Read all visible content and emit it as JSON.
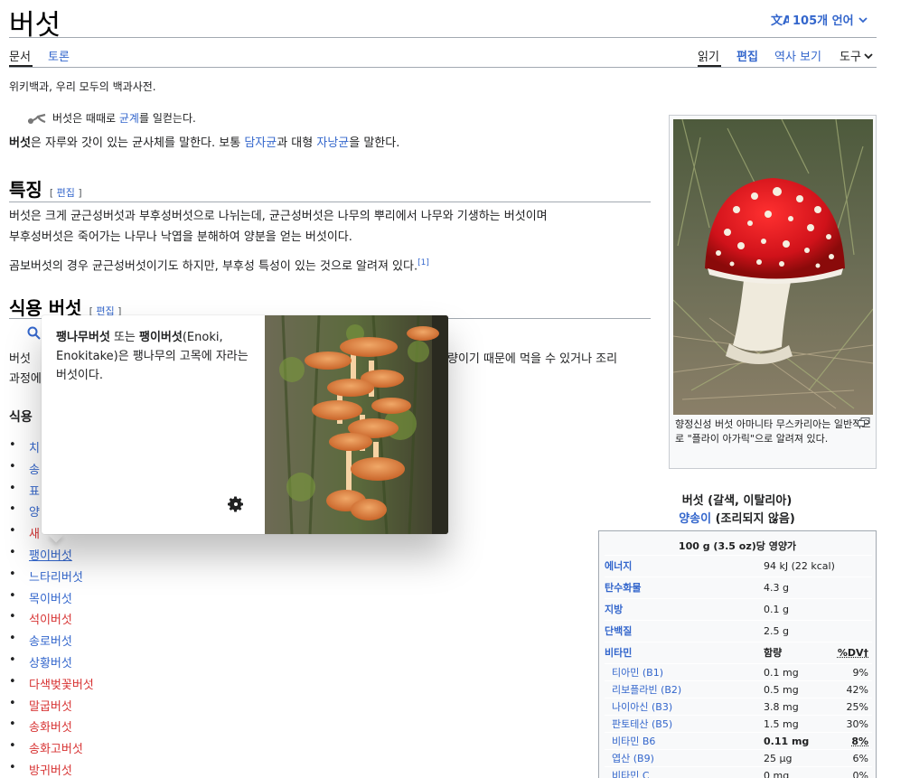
{
  "page": {
    "title": "버섯",
    "languages": "105개 언어",
    "tagline": "위키백과, 우리 모두의 백과사전."
  },
  "tabs": {
    "doc": "문서",
    "talk": "토론",
    "read": "읽기",
    "edit": "편집",
    "history": "역사 보기",
    "tools": "도구"
  },
  "hatnote": {
    "prefix": "버섯은 때때로 ",
    "link": "균계",
    "suffix": "를 일컫는다."
  },
  "intro": {
    "bold": "버섯",
    "t1": "은 자루와 갓이 있는 균사체를 말한다. 보통 ",
    "l1": "담자균",
    "t2": "과 대형 ",
    "l2": "자낭균",
    "t3": "을 말한다."
  },
  "sections": {
    "features": {
      "title": "특징",
      "edit": "편집",
      "p1": "버섯은 크게 균근성버섯과 부후성버섯으로 나뉘는데, 균근성버섯은 나무의 뿌리에서 나무와 기생하는 버섯이며",
      "p2": "부후성버섯은 죽어가는 나무나 낙엽을 분해하여 양분을 얻는 버섯이다.",
      "p3": "곰보버섯의 경우 균근성버섯이기도 하지만, 부후성 특성이 있는 것으로 알려져 있다.",
      "ref": "[1]"
    },
    "edible": {
      "title": "식용 버섯",
      "edit": "편집",
      "p_frag1": "버섯 ",
      "p_frag2": "량이기 때문에 먹을 수 있거나 조리",
      "p_frag3": "과정에",
      "list_title": "식용"
    }
  },
  "list_items": [
    {
      "text": "치",
      "red": false
    },
    {
      "text": "송",
      "red": false
    },
    {
      "text": "표",
      "red": false
    },
    {
      "text": "양",
      "red": false
    },
    {
      "text": "새",
      "red": true
    },
    {
      "text": "팽이버섯",
      "red": false
    },
    {
      "text": "느타리버섯",
      "red": false
    },
    {
      "text": "목이버섯",
      "red": false
    },
    {
      "text": "석이버섯",
      "red": true
    },
    {
      "text": "송로버섯",
      "red": false
    },
    {
      "text": "상황버섯",
      "red": false
    },
    {
      "text": "다색벚꽃버섯",
      "red": true
    },
    {
      "text": "말굽버섯",
      "red": true
    },
    {
      "text": "송화버섯",
      "red": true
    },
    {
      "text": "송화고버섯",
      "red": true
    },
    {
      "text": "방귀버섯",
      "red": true
    }
  ],
  "image_caption": "향정신성 버섯 아마니타 무스카리아는 일반적으로 \"플라이 아가릭\"으로 알려져 있다.",
  "nutrition": {
    "title1": "버섯 (갈색, 이탈리아)",
    "title2_link": "양송이",
    "title2_rest": " (조리되지 않음)",
    "header": "100 g (3.5 oz)당 영양가",
    "rows": [
      {
        "label": "에너지",
        "value": "94 kJ (22 kcal)",
        "dv": ""
      },
      {
        "label": "탄수화물",
        "value": "4.3 g",
        "dv": ""
      },
      {
        "label": "지방",
        "value": "0.1 g",
        "dv": ""
      },
      {
        "label": "단백질",
        "value": "2.5 g",
        "dv": ""
      },
      {
        "label": "비타민",
        "value": "함량",
        "dv": "%DV†"
      }
    ],
    "vitamins": [
      {
        "label": "티아민 (B1)",
        "value": "0.1 mg",
        "dv": "9%"
      },
      {
        "label": "리보플라빈 (B2)",
        "value": "0.5 mg",
        "dv": "42%"
      },
      {
        "label": "나이아신 (B3)",
        "value": "3.8 mg",
        "dv": "25%"
      },
      {
        "label": "판토테산 (B5)",
        "value": "1.5 mg",
        "dv": "30%"
      },
      {
        "label": "비타민 B6",
        "value": "0.11 mg",
        "dv": "8%"
      },
      {
        "label": "엽산 (B9)",
        "value": "25 μg",
        "dv": "6%"
      },
      {
        "label": "비타민 C",
        "value": "0 mg",
        "dv": "0%"
      }
    ]
  },
  "popup": {
    "b1": "팽나무버섯",
    "t1": " 또는 ",
    "b2": "팽이버섯",
    "t2": "(Enoki, Enokitake)은 팽나무의 고목에 자라는 버섯이다."
  },
  "colors": {
    "link": "#3366cc",
    "redlink": "#d73333",
    "accent_border": "#a2a9b1"
  }
}
